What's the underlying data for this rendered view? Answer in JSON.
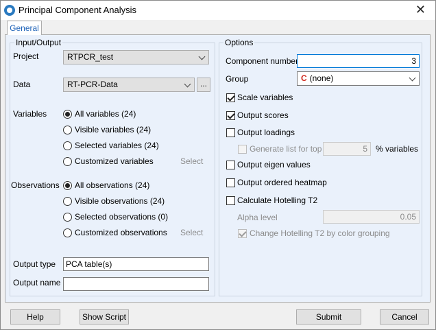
{
  "window": {
    "title": "Principal Component Analysis"
  },
  "tabs": [
    {
      "label": "General"
    }
  ],
  "input_output": {
    "title": "Input/Output",
    "project_label": "Project",
    "project_value": "RTPCR_test",
    "data_label": "Data",
    "data_value": "RT-PCR-Data",
    "data_browse": "...",
    "variables_label": "Variables",
    "variables_options": [
      "All variables (24)",
      "Visible variables (24)",
      "Selected variables (24)",
      "Customized variables"
    ],
    "variables_select": "Select",
    "observations_label": "Observations",
    "observations_options": [
      "All observations (24)",
      "Visible observations (24)",
      "Selected observations (0)",
      "Customized observations"
    ],
    "observations_select": "Select",
    "output_type_label": "Output type",
    "output_type_value": "PCA table(s)",
    "output_name_label": "Output name",
    "output_name_value": ""
  },
  "options": {
    "title": "Options",
    "component_number_label": "Component number",
    "component_number_value": "3",
    "group_label": "Group",
    "group_value": "(none)",
    "group_icon": "C",
    "scale_variables": "Scale variables",
    "output_scores": "Output scores",
    "output_loadings": "Output loadings",
    "generate_list": "Generate list for top",
    "generate_list_value": "5",
    "generate_list_suffix": "% variables",
    "output_eigen": "Output eigen values",
    "output_heatmap": "Output ordered heatmap",
    "hotelling": "Calculate Hotelling T2",
    "alpha_label": "Alpha level",
    "alpha_value": "0.05",
    "change_hotelling": "Change Hotelling T2 by color grouping"
  },
  "buttons": {
    "help": "Help",
    "show_script": "Show Script",
    "submit": "Submit",
    "cancel": "Cancel"
  },
  "colors": {
    "accent": "#0078d7",
    "tab_text": "#1f63b8",
    "panel_bg": "#eaf1fb"
  }
}
